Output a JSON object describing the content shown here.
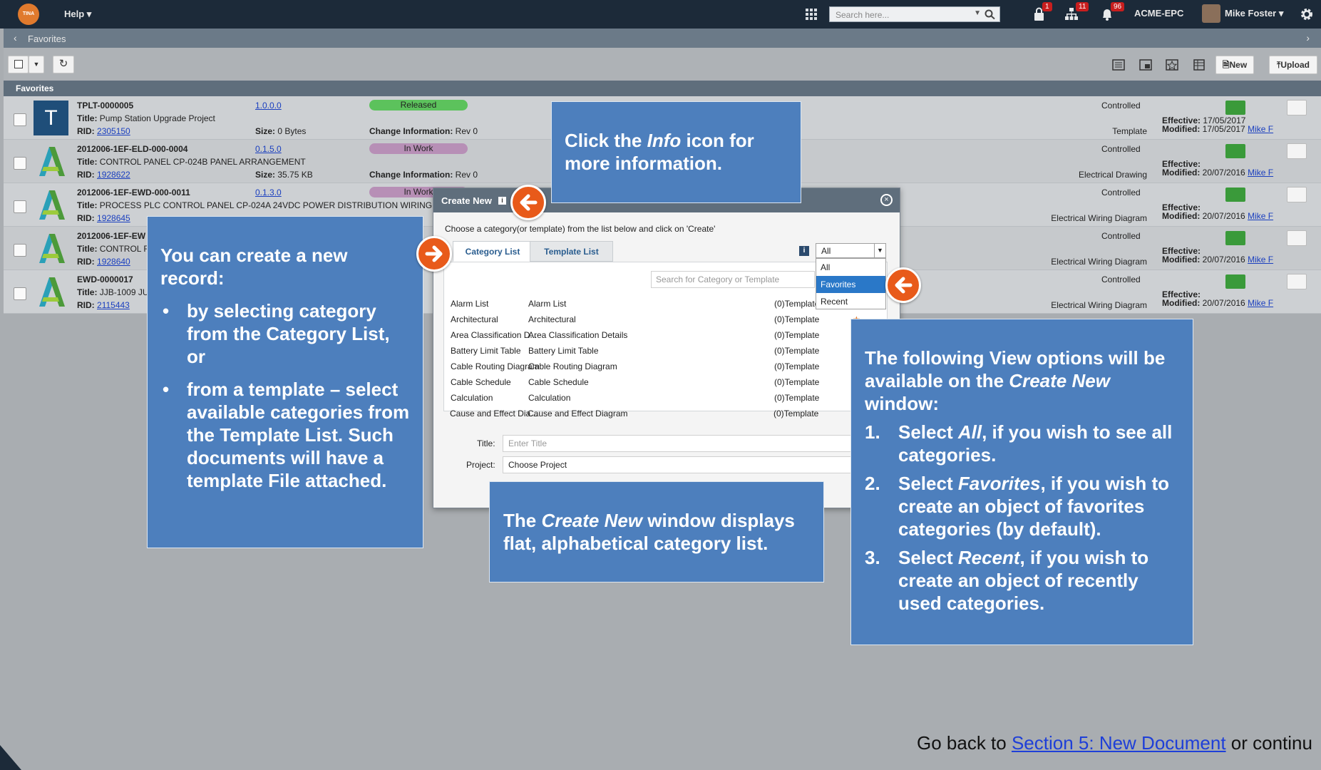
{
  "topbar": {
    "logo_text": "TINA",
    "help_label": "Help ▾",
    "search_placeholder": "Search here...",
    "badges": {
      "lock": "1",
      "tree": "11",
      "bell": "96"
    },
    "org": "ACME-EPC",
    "user": "Mike Foster ▾"
  },
  "breadcrumb": {
    "back": "‹",
    "title": "Favorites",
    "forward": "›"
  },
  "toolbar": {
    "new_label": "New",
    "upload_label": "Upload"
  },
  "list": {
    "header": "Favorites",
    "rows": [
      {
        "id": "TPLT-0000005",
        "version": "1.0.0.0",
        "title": "Pump Station Upgrade Project",
        "rid": "2305150",
        "size": "0 Bytes",
        "status": "Released",
        "status_color": "#5cc25c",
        "change": "Rev 0",
        "control": "Controlled",
        "kind": "Template",
        "effective": "17/05/2017",
        "modified": "17/05/2017",
        "owner": "Mike F",
        "thumb": "T"
      },
      {
        "id": "2012006-1EF-ELD-000-0004",
        "version": "0.1.5.0",
        "title": "CONTROL PANEL CP-024B PANEL ARRANGEMENT",
        "rid": "1928622",
        "size": "35.75 KB",
        "status": "In Work",
        "status_color": "#b78fb6",
        "change": "Rev 0",
        "control": "Controlled",
        "kind": "Electrical Drawing",
        "effective": "",
        "modified": "20/07/2016",
        "owner": "Mike F"
      },
      {
        "id": "2012006-1EF-EWD-000-0011",
        "version": "0.1.3.0",
        "title": "PROCESS PLC CONTROL PANEL CP-024A 24VDC POWER DISTRIBUTION WIRING",
        "rid": "1928645",
        "size": "",
        "status": "In Work",
        "status_color": "#b78fb6",
        "change": "",
        "control": "Controlled",
        "kind": "Electrical Wiring Diagram",
        "effective": "",
        "modified": "20/07/2016",
        "owner": "Mike F"
      },
      {
        "id": "2012006-1EF-EW",
        "version": "",
        "title": "CONTROL F",
        "rid": "1928640",
        "size": "",
        "status": "",
        "status_color": "",
        "change": "",
        "control": "Controlled",
        "kind": "Electrical Wiring Diagram",
        "effective": "",
        "modified": "20/07/2016",
        "owner": "Mike F"
      },
      {
        "id": "EWD-0000017",
        "version": "",
        "title": "JJB-1009 JU",
        "rid": "2115443",
        "size": "",
        "status": "",
        "status_color": "",
        "change": "",
        "control": "Controlled",
        "kind": "Electrical Wiring Diagram",
        "effective": "",
        "modified": "20/07/2016",
        "owner": "Mike F"
      }
    ],
    "labels": {
      "title": "Title:",
      "rid": "RID:",
      "size": "Size:",
      "change": "Change Information:",
      "effective": "Effective:",
      "modified": "Modified:"
    }
  },
  "modal": {
    "title": "Create New",
    "info_glyph": "i",
    "close_glyph": "×",
    "instruction": "Choose a category(or template) from the list below and click on 'Create'",
    "tabs": [
      "Category List",
      "Template List"
    ],
    "search_placeholder": "Search for Category or Template",
    "view_selected": "All",
    "view_options": [
      "All",
      "Favorites",
      "Recent"
    ],
    "categories": [
      {
        "name": "Alarm List",
        "desc": "Alarm List",
        "templates": "(0)Template"
      },
      {
        "name": "Architectural",
        "desc": "Architectural",
        "templates": "(0)Template"
      },
      {
        "name": "Area Classification D...",
        "desc": "Area Classification Details",
        "templates": "(0)Template"
      },
      {
        "name": "Battery Limit Table",
        "desc": "Battery Limit Table",
        "templates": "(0)Template"
      },
      {
        "name": "Cable Routing Diagram",
        "desc": "Cable Routing Diagram",
        "templates": "(0)Template"
      },
      {
        "name": "Cable Schedule",
        "desc": "Cable Schedule",
        "templates": "(0)Template"
      },
      {
        "name": "Calculation",
        "desc": "Calculation",
        "templates": "(0)Template"
      },
      {
        "name": "Cause and Effect Dia...",
        "desc": "Cause and Effect Diagram",
        "templates": "(0)Template"
      }
    ],
    "title_label": "Title:",
    "title_placeholder": "Enter Title",
    "project_label": "Project:",
    "project_value": "Choose Project"
  },
  "callouts": {
    "info": {
      "pre": "Click the ",
      "em": "Info",
      "post": " icon for more information."
    },
    "create": {
      "intro": "You can create a new record:",
      "items": [
        "by selecting category from the Category List, or",
        "from a template – select available categories from the Template List. Such documents will have a template File attached."
      ]
    },
    "window": {
      "pre": "The ",
      "em": "Create New",
      "post": " window displays flat, alphabetical category list."
    },
    "view": {
      "pre": "The following View options will be available on the ",
      "em": "Create New",
      "post": " window:",
      "items": [
        {
          "num": "1.",
          "pre": "Select ",
          "em": "All",
          "post": ", if you wish to see all categories."
        },
        {
          "num": "2.",
          "pre": "Select ",
          "em": "Favorites",
          "post": ", if you wish to create an object of favorites categories (by default)."
        },
        {
          "num": "3.",
          "pre": "Select ",
          "em": "Recent",
          "post": ", if you wish to create an object of recently used categories."
        }
      ]
    }
  },
  "footer": {
    "pre": "Go back to ",
    "link": "Section 5: New Document",
    "post": " or continu"
  }
}
